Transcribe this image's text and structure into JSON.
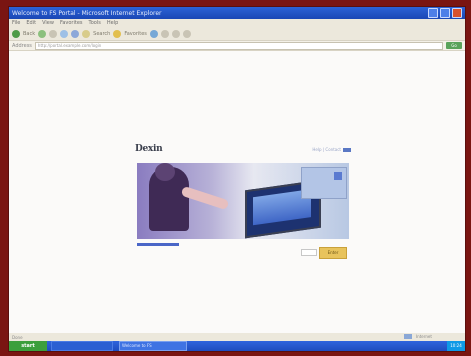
{
  "window": {
    "title": "Welcome to FS Portal - Microsoft Internet Explorer"
  },
  "menu": [
    "File",
    "Edit",
    "View",
    "Favorites",
    "Tools",
    "Help"
  ],
  "toolbar": {
    "back_label": "Back",
    "forward_label": "",
    "search_label": "Search",
    "favorites_label": "Favorites",
    "media_label": ""
  },
  "address": {
    "label": "Address",
    "value": "http://portal.example.com/login",
    "go_label": "Go"
  },
  "page": {
    "logo_text": "Dexin",
    "top_link": "Help | Contact",
    "enter_label": "Enter"
  },
  "status": {
    "text": "Done",
    "zone": "Internet"
  },
  "taskbar": {
    "start_label": "start",
    "task_label": "Welcome to FS",
    "clock": "10:24"
  },
  "colors": {
    "frame": "#7a1512",
    "accent": "#1a47b5",
    "hero": "#8a7cc0",
    "button": "#e8c35c"
  }
}
